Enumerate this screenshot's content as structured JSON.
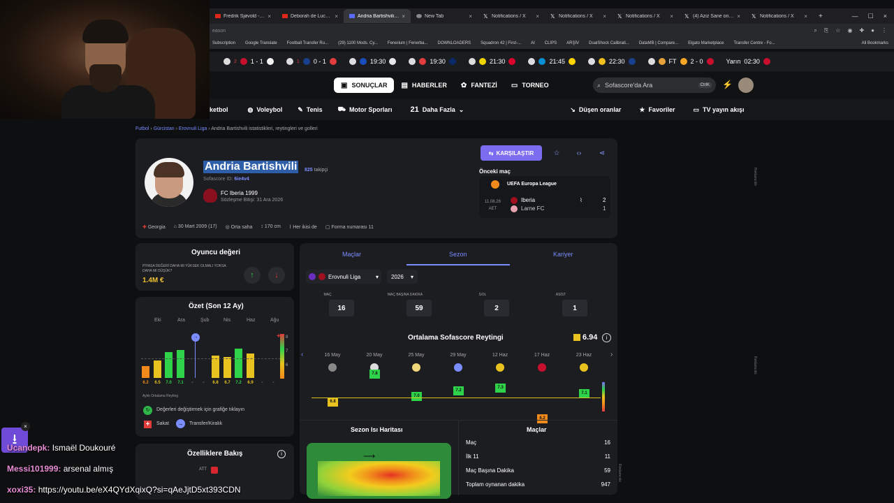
{
  "browser": {
    "tabs": [
      {
        "label": "Fredrik Sjøvold - Soli...",
        "icon": "youtube-icon"
      },
      {
        "label": "Deborah de Luca @ C...",
        "icon": "youtube-icon"
      },
      {
        "label": "Andria Bartishvili istatisti...",
        "icon": "sofascore-icon",
        "active": true
      },
      {
        "label": "New Tab",
        "icon": "chrome-icon"
      },
      {
        "label": "Notifications / X",
        "icon": "x-icon"
      },
      {
        "label": "Notifications / X",
        "icon": "x-icon"
      },
      {
        "label": "Notifications / X",
        "icon": "x-icon"
      },
      {
        "label": "(4) Aziz Sane on X: \"Ş...",
        "icon": "x-icon"
      },
      {
        "label": "Notifications / X",
        "icon": "x-icon"
      }
    ],
    "address_fragment": "eason",
    "bookmarks": [
      "Subscription",
      "Google Translate",
      "Football Transfer Ru...",
      "(29) 1100 Mods. Cy...",
      "Fenerium | Fenerba...",
      "DOWNLOADERS",
      "Squadron 42 | First-...",
      "AI",
      "CLIPS",
      "ARŞİV",
      "DualShock Calibrati...",
      "DataMB | Compare...",
      "Elgato Marketplace",
      "Transfer Centre - Fo..."
    ],
    "bookmarks_all": "All Bookmarks"
  },
  "ticker": [
    {
      "a": "2",
      "score": "1 - 1"
    },
    {
      "a": "1",
      "score": "0 - 1"
    },
    {
      "score": "19:30"
    },
    {
      "score": "19:30"
    },
    {
      "score": "21:30"
    },
    {
      "score": "21:45"
    },
    {
      "score": "22:30"
    },
    {
      "score": "FT",
      "extra": "2 - 0"
    }
  ],
  "ticker_tomorrow": "Yarın",
  "ticker_time": "02:30",
  "nav": {
    "sonuclar": "SONUÇLAR",
    "haberler": "HABERLER",
    "fantezi": "FANTEZİ",
    "torneo": "TORNEO",
    "search_placeholder": "Sofascore'da Ara",
    "search_kbd": "CtrlK"
  },
  "sports": {
    "basketbol": "ketbol",
    "voleybol": "Voleybol",
    "tenis": "Tenis",
    "motor": "Motor Sporları",
    "more_count": "21",
    "more": "Daha Fazla",
    "dusen": "Düşen oranlar",
    "favoriler": "Favoriler",
    "tv": "TV yayın akışı"
  },
  "breadcrumb": [
    "Futbol",
    "Gürcistan",
    "Erovnuli Liga",
    "Andria Bartishvili istatistikleri, reytingleri ve golleri"
  ],
  "player": {
    "name": "Andria Bartishvili",
    "followers": "825",
    "followers_label": "takipçi",
    "sofascore_id_label": "Sofascore ID:",
    "sofascore_id": "6ie4v4",
    "club": "FC Iberia 1999",
    "contract": "Sözleşme Bitişi: 31 Ara 2026",
    "country": "Georgia",
    "birth": "30 Mart 2009 (17)",
    "position": "Orta saha",
    "height": "170 cm",
    "foot": "Her ikisi de",
    "shirt": "Forma numarası 11"
  },
  "compare": "KARŞILAŞTIR",
  "prev_match": {
    "label": "Önceki maç",
    "competition": "UEFA Europa League",
    "date": "11.08.26",
    "status": "AET",
    "home": "Iberia",
    "away": "Larne FC",
    "home_score": "2",
    "away_score": "1"
  },
  "value": {
    "title": "Oyuncu değeri",
    "question": "PİYASA DEĞERİ DAHA MI YÜKSEK OLMALI YOKSA DAHA MI DÜŞÜK?",
    "amount": "1.4M €"
  },
  "ozet": {
    "title": "Özet (Son 12 Ay)",
    "months": [
      "Eki",
      "Ara",
      "Şub",
      "Nis",
      "Haz",
      "Ağu"
    ],
    "bar_labels": [
      "6.2",
      "6.5",
      "7.0",
      "7.1",
      "-",
      "-",
      "6.8",
      "6.7",
      "7.2",
      "6.9",
      "-",
      "-"
    ],
    "bars": [
      6.2,
      6.5,
      7.0,
      7.1,
      null,
      null,
      6.8,
      6.7,
      7.2,
      6.9,
      null,
      null
    ],
    "monthly_label": "Aylık Ortalama Reyting",
    "note": "Değerleri değiştirmek için grafiğe tıklayın",
    "sakat": "Sakat",
    "transfer": "Transfer/Kiralık"
  },
  "ozel": {
    "title": "Özelliklere Bakış",
    "att": "ATT"
  },
  "stats_tabs": {
    "maclar": "Maçlar",
    "sezon": "Sezon",
    "kariyer": "Kariyer"
  },
  "league_select": "Erovnuli Liga",
  "year_select": "2026",
  "season_stats": [
    {
      "label": "MAÇ",
      "value": "16"
    },
    {
      "label": "MAÇ BAŞINA DAKİKA",
      "value": "59"
    },
    {
      "label": "GOL",
      "value": "2"
    },
    {
      "label": "ASİST",
      "value": "1"
    }
  ],
  "avg": {
    "title": "Ortalama Sofascore Reytingi",
    "value": "6.94"
  },
  "ratings": [
    {
      "date": "16 May",
      "rating": 6.8,
      "label": "6.8"
    },
    {
      "date": "20 May",
      "rating": 7.8,
      "label": "7.8"
    },
    {
      "date": "25 May",
      "rating": 7.0,
      "label": "7.0"
    },
    {
      "date": "29 May",
      "rating": 7.2,
      "label": "7.2"
    },
    {
      "date": "12 Haz",
      "rating": 7.3,
      "label": "7.3"
    },
    {
      "date": "17 Haz",
      "rating": 6.2,
      "label": "6.2"
    },
    {
      "date": "23 Haz",
      "rating": 7.1,
      "label": "7.1"
    }
  ],
  "heatmap_title": "Sezon Isı Haritası",
  "matches": {
    "title": "Maçlar",
    "rows": [
      {
        "label": "Maç",
        "value": "16"
      },
      {
        "label": "İlk 11",
        "value": "11"
      },
      {
        "label": "Maç Başına Dakika",
        "value": "59"
      },
      {
        "label": "Toplam oynanan dakika",
        "value": "947"
      }
    ]
  },
  "ad_label": "Reklamcılık",
  "chat": [
    {
      "user": "Ucandepk:",
      "msg": "Ismaël Doukouré"
    },
    {
      "user": "Messi101999:",
      "msg": "arsenal almış"
    },
    {
      "user": "xoxi35:",
      "msg": "https://youtu.be/eX4QYdXqixQ?si=qAeJjtD5xt393CDN"
    }
  ],
  "colors": {
    "accent": "#7b8cff",
    "button": "#7b6cf0",
    "value": "#f1c232",
    "green": "#2ed34a",
    "yellow": "#e8c21e",
    "orange": "#f28a1b"
  }
}
